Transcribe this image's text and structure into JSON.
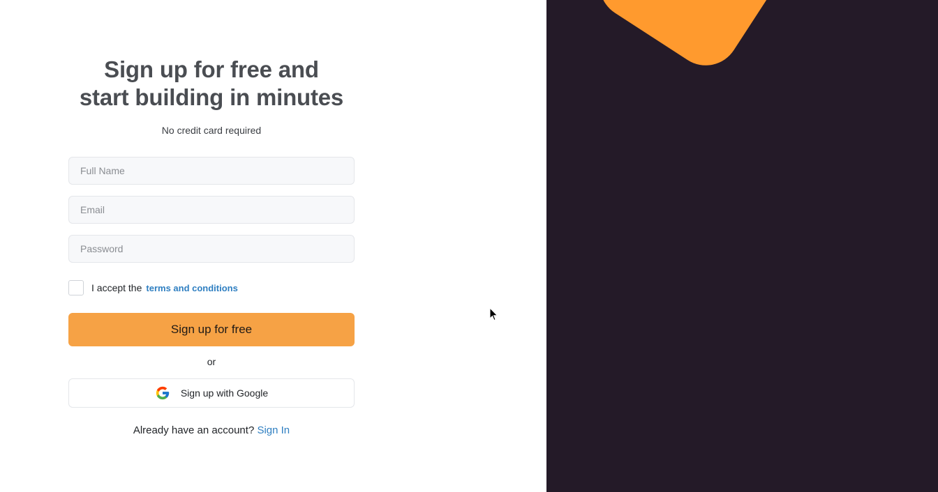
{
  "form": {
    "heading_line1": "Sign up for free and",
    "heading_line2": "start building in minutes",
    "subtext": "No credit card required",
    "full_name_placeholder": "Full Name",
    "email_placeholder": "Email",
    "password_placeholder": "Password",
    "terms_prefix": "I accept the",
    "terms_link": "terms and conditions",
    "submit_label": "Sign up for free",
    "or_label": "or",
    "google_label": "Sign up with Google",
    "signin_prompt": "Already have an account?",
    "signin_link": "Sign In"
  },
  "icons": {
    "google": "google-icon",
    "cursor": "mouse-pointer-icon"
  },
  "colors": {
    "primary_button": "#f6a245",
    "link": "#2f7fc1",
    "right_panel": "#241a28",
    "accent_shape": "#ff9a2e",
    "heading": "#4a4d52"
  }
}
